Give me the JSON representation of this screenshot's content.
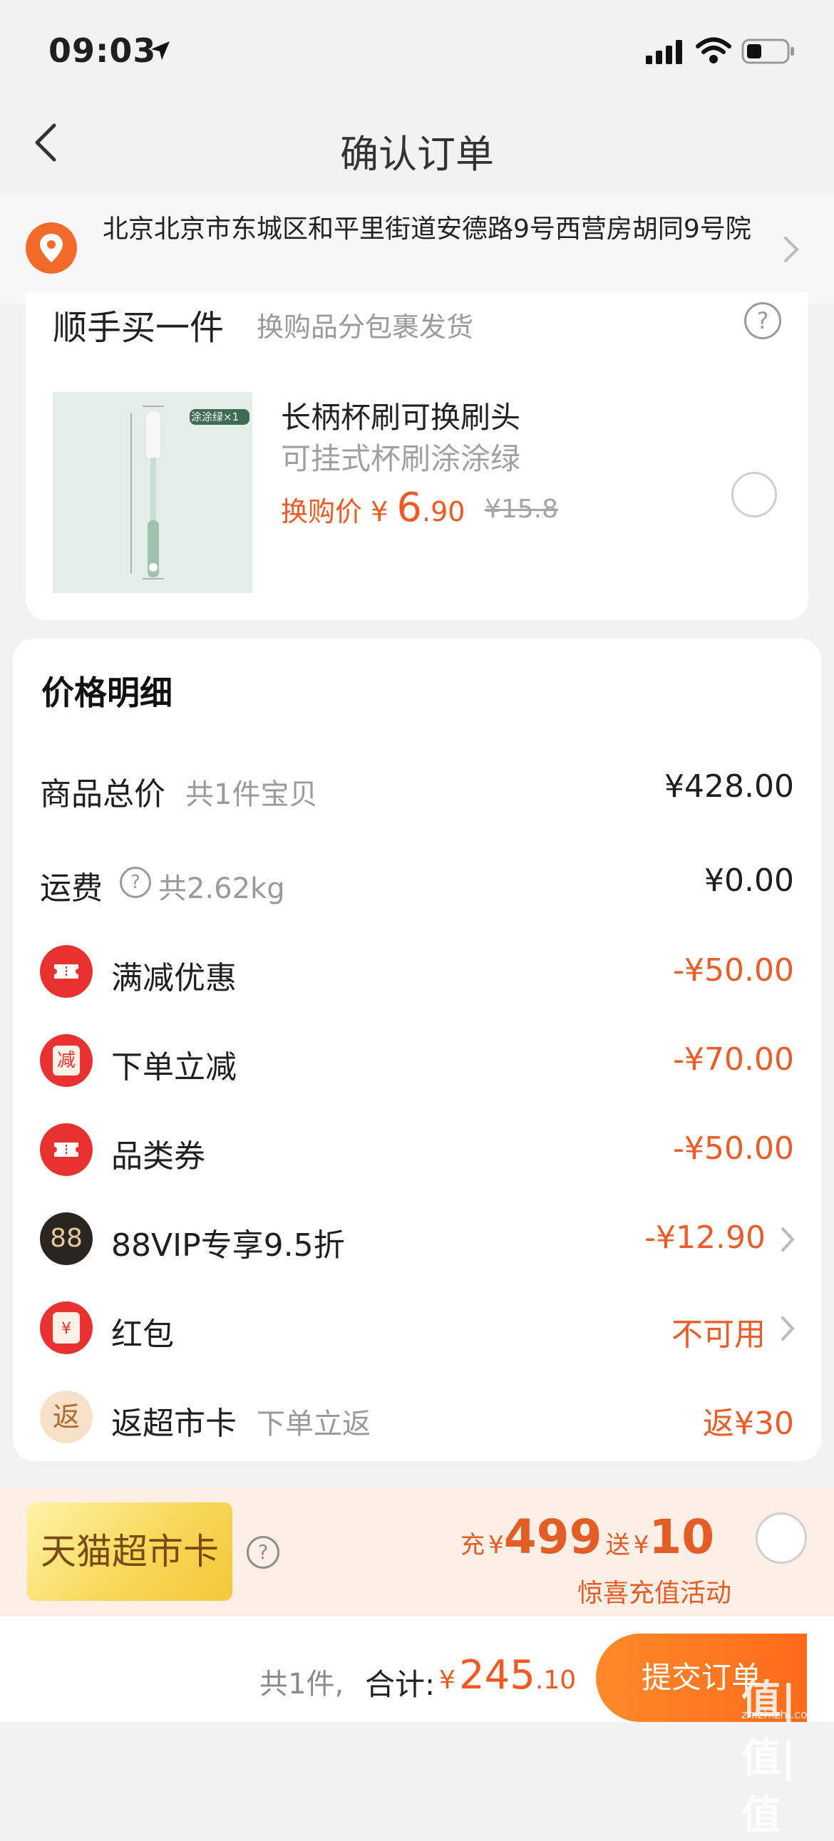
{
  "status_bar": {
    "time": "09:03"
  },
  "nav": {
    "title": "确认订单"
  },
  "address": {
    "text": "北京北京市东城区和平里街道安德路9号西营房胡同9号院"
  },
  "add_on": {
    "title": "顺手买一件",
    "subtitle": "换购品分包裹发货",
    "help": "?",
    "product": {
      "image_tag": "涂涂绿×1",
      "name": "长柄杯刷可换刷头",
      "spec": "可挂式杯刷涂涂绿",
      "price_label": "换购价",
      "currency": "¥",
      "price_int": "6",
      "price_dec": ".90",
      "original_price": "¥15.8"
    }
  },
  "price_detail": {
    "title": "价格明细",
    "rows": [
      {
        "label": "商品总价",
        "note": "共1件宝贝",
        "amount": "¥428.00"
      },
      {
        "label": "运费",
        "note": "共2.62kg",
        "amount": "¥0.00"
      },
      {
        "label": "满减优惠",
        "amount": "-¥50.00",
        "icon": "ticket-icon"
      },
      {
        "label": "下单立减",
        "amount": "-¥70.00",
        "icon": "discount-icon",
        "icon_text": "减"
      },
      {
        "label": "品类券",
        "amount": "-¥50.00",
        "icon": "ticket-icon"
      },
      {
        "label": "88VIP专享9.5折",
        "amount": "-¥12.90",
        "icon": "vip88-icon",
        "icon_text": "88"
      },
      {
        "label": "红包",
        "amount": "不可用",
        "icon": "red-packet-icon",
        "icon_text": "¥"
      },
      {
        "label": "返超市卡",
        "note": "下单立返",
        "amount": "返¥30",
        "icon": "rebate-icon",
        "icon_text": "返"
      }
    ]
  },
  "supermarket_card": {
    "name": "天猫超市卡",
    "help": "?",
    "recharge_prefix": "充",
    "currency": "¥",
    "recharge_amount": "499",
    "gift_prefix": "送",
    "gift_amount": "10",
    "note": "惊喜充值活动"
  },
  "footer": {
    "count": "共1件,",
    "total_label": "合计:",
    "currency": "¥",
    "total_int": "245",
    "total_dec": ".10",
    "submit_label": "提交订单",
    "watermark": "值|值|值",
    "watermark_url": "zhizhizhi.com"
  },
  "colors": {
    "accent": "#f05a22",
    "discount_red": "#ea5d26",
    "icon_red": "#e8322f"
  }
}
